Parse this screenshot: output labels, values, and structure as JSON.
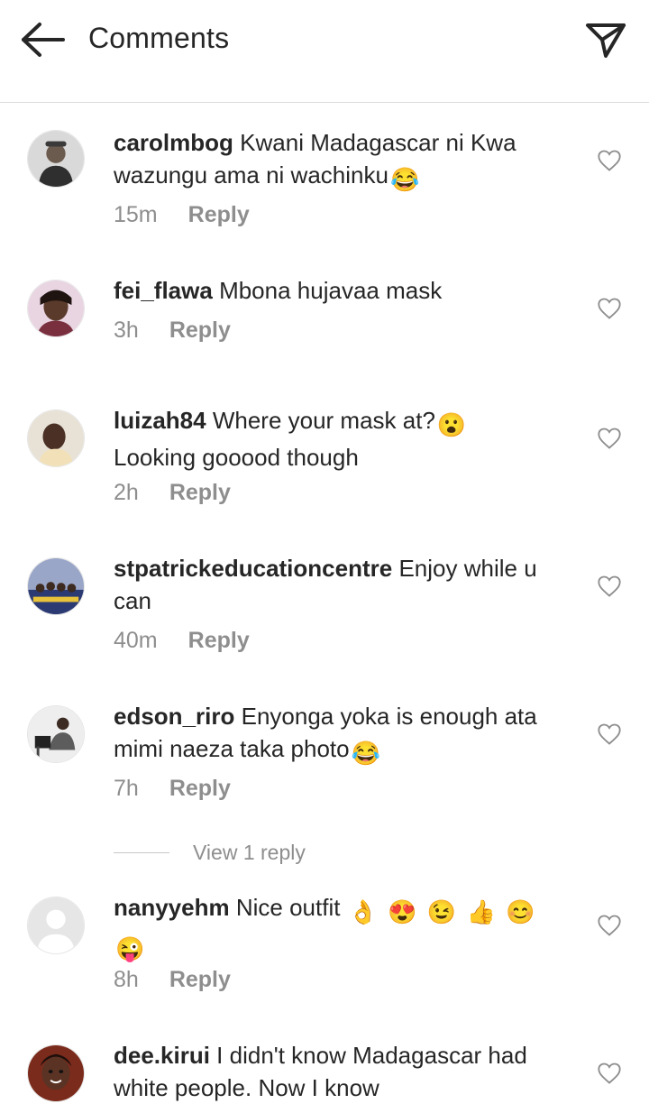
{
  "header": {
    "title": "Comments",
    "back_icon": "arrow-left-icon",
    "send_icon": "paper-plane-icon"
  },
  "comments": [
    {
      "username": "carolmbog",
      "text": "Kwani Madagascar ni Kwa wazungu ama ni wachinku",
      "emoji": [
        "😂"
      ],
      "time": "15m",
      "reply_label": "Reply"
    },
    {
      "username": "fei_flawa",
      "text": "Mbona hujavaa mask",
      "emoji": [],
      "time": "3h",
      "reply_label": "Reply"
    },
    {
      "username": "luizah84",
      "text": "Where your mask at?",
      "text2": "Looking gooood though",
      "emoji": [
        "😮"
      ],
      "time": "2h",
      "reply_label": "Reply"
    },
    {
      "username": "stpatrickeducationcentre",
      "text": "Enjoy while u can",
      "emoji": [],
      "time": "40m",
      "reply_label": "Reply"
    },
    {
      "username": "edson_riro",
      "text": "Enyonga yoka is enough ata mimi naeza taka photo",
      "emoji": [
        "😂"
      ],
      "time": "7h",
      "reply_label": "Reply",
      "view_replies": "View 1 reply"
    },
    {
      "username": "nanyyehm",
      "text": "Nice outfit",
      "emoji": [
        "👌",
        "😍",
        "😉",
        "👍",
        "😊",
        "😜"
      ],
      "time": "8h",
      "reply_label": "Reply"
    },
    {
      "username": "dee.kirui",
      "text": "I didn't know Madagascar had white people. Now I know",
      "emoji": [],
      "time": "",
      "reply_label": ""
    }
  ],
  "colors": {
    "text": "#262626",
    "muted": "#8e8e8e",
    "divider": "#dbdbdb"
  }
}
